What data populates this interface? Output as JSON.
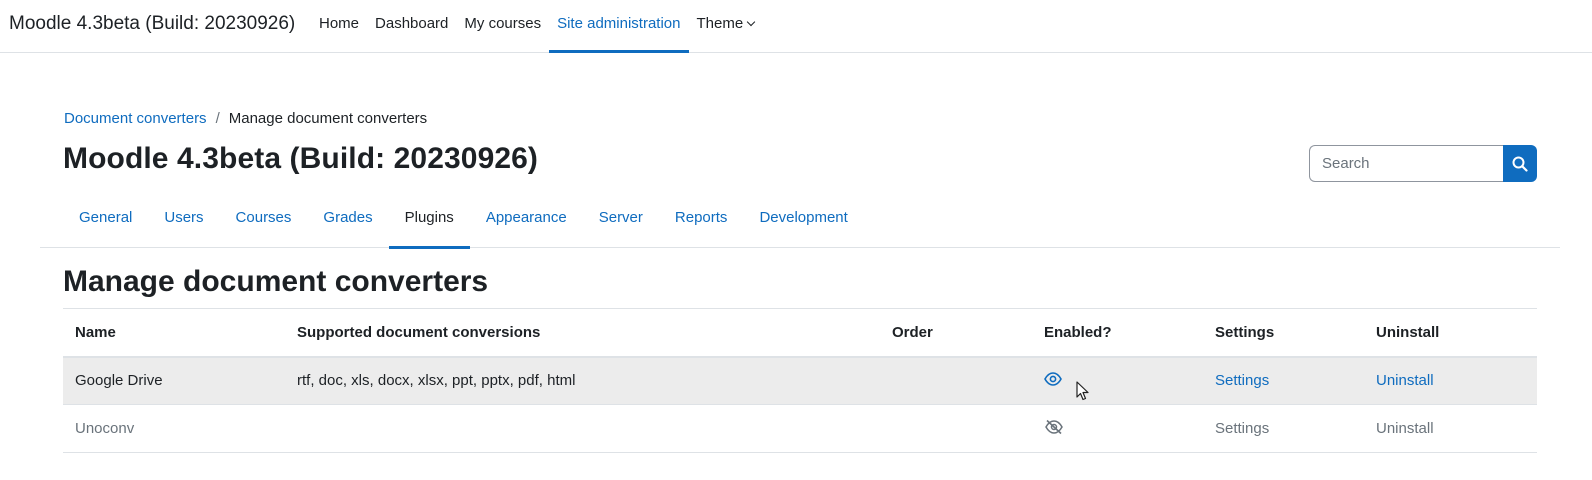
{
  "brand": "Moodle 4.3beta (Build: 20230926)",
  "primary_nav": [
    {
      "label": "Home"
    },
    {
      "label": "Dashboard"
    },
    {
      "label": "My courses"
    },
    {
      "label": "Site administration",
      "active": true
    },
    {
      "label": "Theme"
    }
  ],
  "breadcrumb": {
    "parent": "Document converters",
    "separator": "/",
    "current": "Manage document converters"
  },
  "page_title": "Moodle 4.3beta (Build: 20230926)",
  "search": {
    "placeholder": "Search",
    "icon": "search-icon"
  },
  "secondary_nav": [
    {
      "label": "General"
    },
    {
      "label": "Users"
    },
    {
      "label": "Courses"
    },
    {
      "label": "Grades"
    },
    {
      "label": "Plugins",
      "active": true
    },
    {
      "label": "Appearance"
    },
    {
      "label": "Server"
    },
    {
      "label": "Reports"
    },
    {
      "label": "Development"
    }
  ],
  "section_title": "Manage document converters",
  "table": {
    "headers": [
      "Name",
      "Supported document conversions",
      "Order",
      "Enabled?",
      "Settings",
      "Uninstall"
    ],
    "rows": [
      {
        "name": "Google Drive",
        "conversions": "rtf, doc, xls, docx, xlsx, ppt, pptx, pdf, html",
        "order": "",
        "enabled_icon": "eye-icon",
        "enabled": true,
        "settings": "Settings",
        "uninstall": "Uninstall"
      },
      {
        "name": "Unoconv",
        "conversions": "",
        "order": "",
        "enabled_icon": "eye-slash-icon",
        "enabled": false,
        "settings": "Settings",
        "uninstall": "Uninstall"
      }
    ]
  },
  "colors": {
    "link": "#0f6cbf",
    "text": "#1d2125",
    "muted": "#6a737b",
    "row_hover": "#ececec"
  }
}
